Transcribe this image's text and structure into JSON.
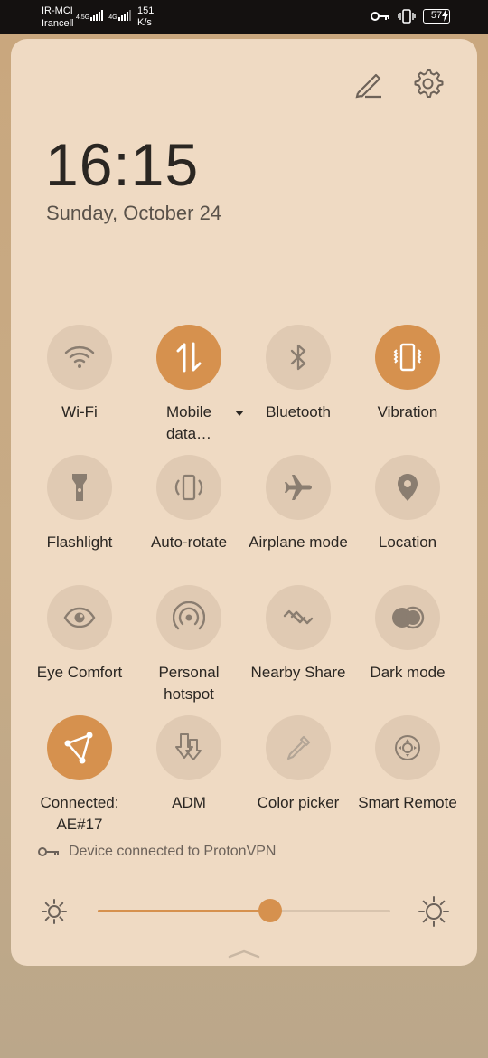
{
  "status_bar": {
    "carrier_1": "IR-MCI",
    "carrier_2": "Irancell",
    "net_1": "4.5G",
    "net_2": "4G",
    "speed_value": "151",
    "speed_unit": "K/s",
    "battery": "57",
    "icons": [
      "key-icon",
      "vibrate-icon",
      "charging-bolt-icon"
    ]
  },
  "header": {
    "time": "16:15",
    "date": "Sunday, October 24",
    "edit_icon": "pencil-icon",
    "settings_icon": "gear-icon"
  },
  "tiles": [
    {
      "id": "wifi",
      "label": "Wi-Fi",
      "icon": "wifi-icon",
      "active": false
    },
    {
      "id": "mobile-data",
      "label": "Mobile data…",
      "icon": "mobile-data-icon",
      "active": true
    },
    {
      "id": "bluetooth",
      "label": "Bluetooth",
      "icon": "bluetooth-icon",
      "active": false
    },
    {
      "id": "vibration",
      "label": "Vibration",
      "icon": "vibrate-icon",
      "active": true
    },
    {
      "id": "flashlight",
      "label": "Flashlight",
      "icon": "flashlight-icon",
      "active": false
    },
    {
      "id": "auto-rotate",
      "label": "Auto-rotate",
      "icon": "rotate-icon",
      "active": false
    },
    {
      "id": "airplane",
      "label": "Airplane mode",
      "icon": "airplane-icon",
      "active": false
    },
    {
      "id": "location",
      "label": "Location",
      "icon": "location-pin-icon",
      "active": false
    },
    {
      "id": "eye-comfort",
      "label": "Eye Comfort",
      "icon": "eye-icon",
      "active": false
    },
    {
      "id": "hotspot",
      "label": "Personal hotspot",
      "icon": "hotspot-icon",
      "active": false
    },
    {
      "id": "nearby-share",
      "label": "Nearby Share",
      "icon": "nearby-share-icon",
      "active": false
    },
    {
      "id": "dark-mode",
      "label": "Dark mode",
      "icon": "dark-mode-icon",
      "active": false
    },
    {
      "id": "vpn",
      "label": "Connected: AE#17",
      "icon": "vpn-icon",
      "active": true
    },
    {
      "id": "adm",
      "label": "ADM",
      "icon": "download-manager-icon",
      "active": false
    },
    {
      "id": "color-picker",
      "label": "Color picker",
      "icon": "eyedropper-icon",
      "active": false
    },
    {
      "id": "smart-remote",
      "label": "Smart Remote",
      "icon": "remote-icon",
      "active": false
    }
  ],
  "vpn_status": "Device connected to ProtonVPN",
  "brightness": {
    "level": 0.59
  },
  "colors": {
    "accent": "#d6914e",
    "panel": "#efdac3",
    "tile": "#e0cab3",
    "icon": "#8a7d70"
  }
}
